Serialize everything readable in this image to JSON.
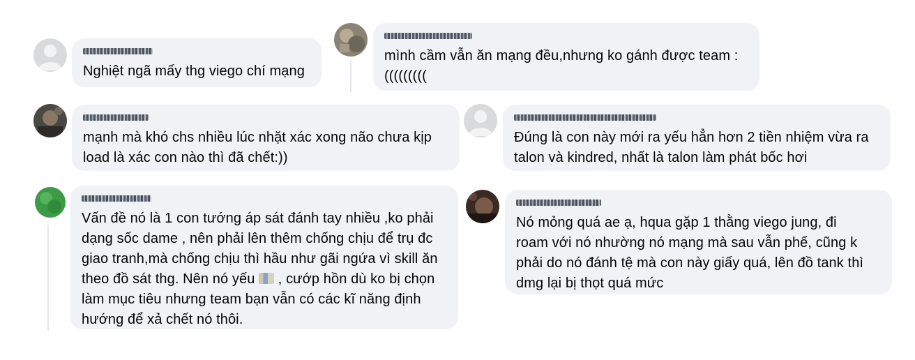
{
  "comments": [
    {
      "avatar": "default-avatar",
      "name": "",
      "text": "Nghiệt ngã mấy thg viego chí mạng"
    },
    {
      "avatar": "photo-avatar",
      "name": "",
      "text": "mình cầm vẫn ăn mạng đều,nhưng ko gánh được team :\n((((((((("
    },
    {
      "avatar": "photo-avatar",
      "name": "",
      "text": "mạnh mà khó chs nhiều lúc nhặt xác xong não chưa kịp\nload là xác con nào thì đã chết:))"
    },
    {
      "avatar": "default-avatar",
      "name": "",
      "text": "Đúng là con này mới ra yếu hẳn hơn 2 tiền nhiệm vừa ra\ntalon và kindred, nhất là talon làm phát bốc hơi"
    },
    {
      "avatar": "photo-avatar",
      "name": "",
      "text_part1": "Vấn đề nó là 1 con tướng áp sát đánh tay nhiều ,ko phải\ndạng sốc dame , nên phải lên thêm chống chịu để trụ đc\ngiao tranh,mà chống chịu thì hầu như gãi ngứa vì skill ăn\ntheo đồ sát thg. Nên nó yếu ",
      "text_part2": " , cướp hồn dù ko bị chọn\nlàm mục tiêu nhưng team bạn vẫn có các kĩ năng định\nhướng để xả chết nó thôi."
    },
    {
      "avatar": "photo-avatar",
      "name": "",
      "text": "Nó mỏng quá ae ạ, hqua gặp 1 thằng viego jung, đi\nroam với nó nhường nó mạng mà sau vẫn phế, cũng k\nphải do nó đánh tệ mà con này giấy quá, lên đồ tank thì\ndmg lại bị thọt quá mức"
    }
  ]
}
